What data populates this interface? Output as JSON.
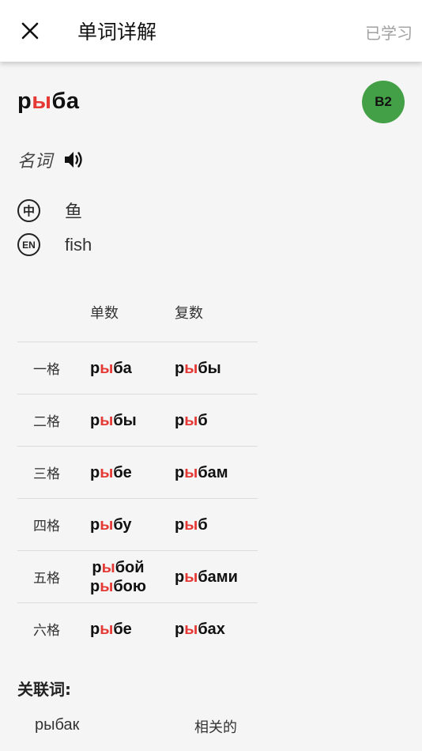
{
  "header": {
    "title": "单词详解",
    "learned_label": "已学习"
  },
  "word": {
    "pre": "р",
    "stress": "ы",
    "post": "ба",
    "level": "B2",
    "part_of_speech": "名词"
  },
  "translations": [
    {
      "icon_label": "中",
      "text": "鱼"
    },
    {
      "icon_label": "EN",
      "text": "fish"
    }
  ],
  "declension": {
    "headers": {
      "singular": "单数",
      "plural": "复数"
    },
    "rows": [
      {
        "case": "一格",
        "singular": [
          {
            "pre": "р",
            "stress": "ы",
            "post": "ба"
          }
        ],
        "plural": [
          {
            "pre": "р",
            "stress": "ы",
            "post": "бы"
          }
        ]
      },
      {
        "case": "二格",
        "singular": [
          {
            "pre": "р",
            "stress": "ы",
            "post": "бы"
          }
        ],
        "plural": [
          {
            "pre": "р",
            "stress": "ы",
            "post": "б"
          }
        ]
      },
      {
        "case": "三格",
        "singular": [
          {
            "pre": "р",
            "stress": "ы",
            "post": "бе"
          }
        ],
        "plural": [
          {
            "pre": "р",
            "stress": "ы",
            "post": "бам"
          }
        ]
      },
      {
        "case": "四格",
        "singular": [
          {
            "pre": "р",
            "stress": "ы",
            "post": "бу"
          }
        ],
        "plural": [
          {
            "pre": "р",
            "stress": "ы",
            "post": "б"
          }
        ]
      },
      {
        "case": "五格",
        "singular": [
          {
            "pre": "р",
            "stress": "ы",
            "post": "бой"
          },
          {
            "pre": "р",
            "stress": "ы",
            "post": "бою"
          }
        ],
        "plural": [
          {
            "pre": "р",
            "stress": "ы",
            "post": "бами"
          }
        ]
      },
      {
        "case": "六格",
        "singular": [
          {
            "pre": "р",
            "stress": "ы",
            "post": "бе"
          }
        ],
        "plural": [
          {
            "pre": "р",
            "stress": "ы",
            "post": "бах"
          }
        ]
      }
    ]
  },
  "related": {
    "title": "关联词:",
    "items": [
      {
        "word": "рыбак",
        "meaning": "相关的"
      }
    ]
  },
  "colors": {
    "stress": "#e53935",
    "badge": "#43a047",
    "muted": "#a0a0a0"
  },
  "icons": {
    "close": "close-icon",
    "speaker": "speaker-icon"
  }
}
